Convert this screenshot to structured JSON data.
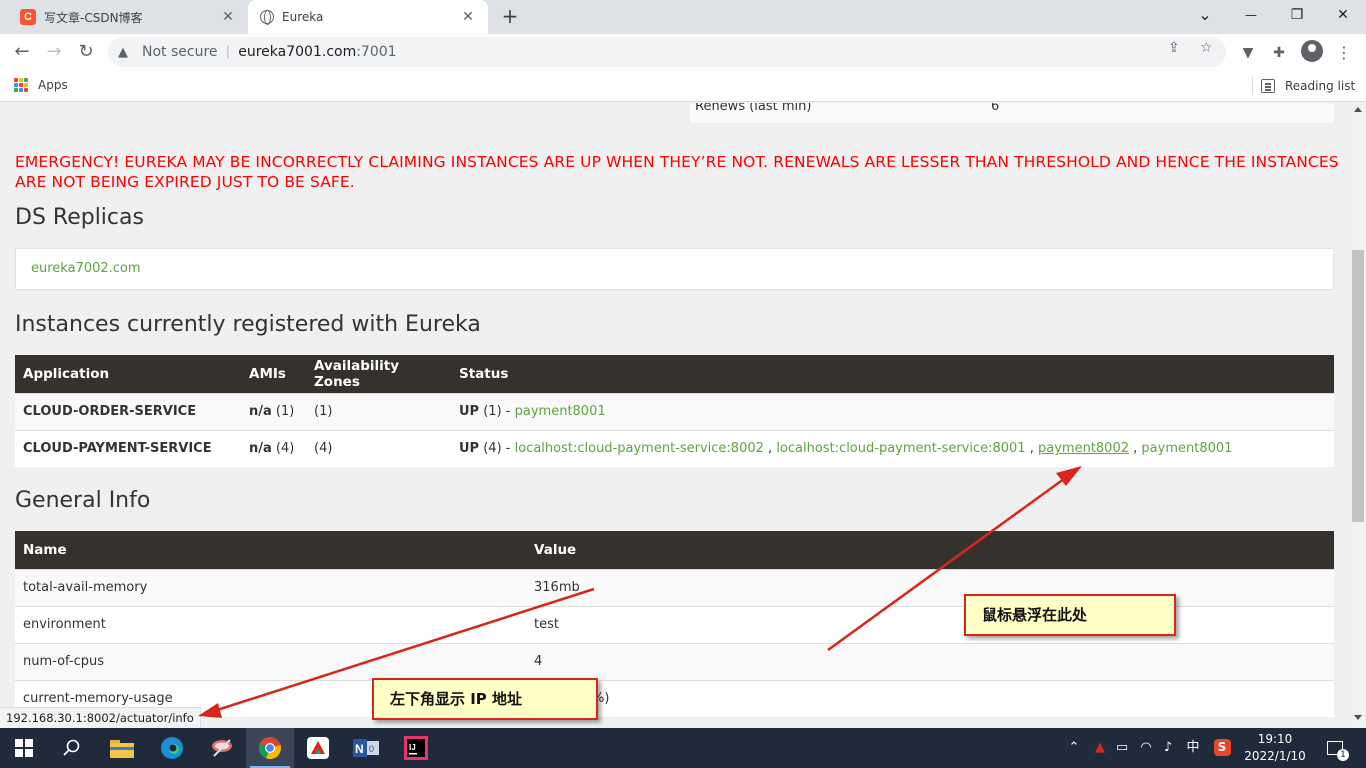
{
  "browser": {
    "tabs": [
      {
        "title": "写文章-CSDN博客",
        "favicon": "C",
        "active": false
      },
      {
        "title": "Eureka",
        "active": true
      }
    ],
    "close_glyph": "✕",
    "new_tab_glyph": "+",
    "window_controls": {
      "chevron": "⌄",
      "minimize": "—",
      "restore": "❐",
      "close": "✕"
    },
    "nav": {
      "back": "←",
      "forward": "→",
      "reload": "↻"
    },
    "security_label": "Not secure",
    "url_host": "eureka7001.com",
    "url_port": ":7001",
    "bookmarks": {
      "apps_label": "Apps",
      "reading_list_label": "Reading list"
    }
  },
  "page": {
    "renews": {
      "label": "Renews (last min)",
      "value": "6"
    },
    "emergency": "EMERGENCY! EUREKA MAY BE INCORRECTLY CLAIMING INSTANCES ARE UP WHEN THEY’RE NOT. RENEWALS ARE LESSER THAN THRESHOLD AND HENCE THE INSTANCES ARE NOT BEING EXPIRED JUST TO BE SAFE.",
    "ds_replicas": {
      "title": "DS Replicas",
      "link": "eureka7002.com"
    },
    "instances": {
      "title": "Instances currently registered with Eureka",
      "headers": [
        "Application",
        "AMIs",
        "Availability Zones",
        "Status"
      ],
      "rows": [
        {
          "app": "CLOUD-ORDER-SERVICE",
          "ami": "n/a",
          "ami_count": "(1)",
          "zones": "(1)",
          "status": "UP",
          "status_count": "(1) -",
          "links": [
            "payment8001"
          ]
        },
        {
          "app": "CLOUD-PAYMENT-SERVICE",
          "ami": "n/a",
          "ami_count": "(4)",
          "zones": "(4)",
          "status": "UP",
          "status_count": "(4) -",
          "links": [
            "localhost:cloud-payment-service:8002",
            "localhost:cloud-payment-service:8001",
            "payment8002",
            "payment8001"
          ]
        }
      ],
      "link_separator": ","
    },
    "general_info": {
      "title": "General Info",
      "headers": [
        "Name",
        "Value"
      ],
      "rows": [
        {
          "name": "total-avail-memory",
          "value": "316mb"
        },
        {
          "name": "environment",
          "value": "test"
        },
        {
          "name": "num-of-cpus",
          "value": "4"
        },
        {
          "name": "current-memory-usage",
          "value": "%)"
        }
      ]
    }
  },
  "status_url": "192.168.30.1:8002/actuator/info",
  "annotations": {
    "hover_note": "鼠标悬浮在此处",
    "ip_note": "左下角显示 IP 地址",
    "arrow_color": "#d9261c"
  },
  "taskbar": {
    "ime": "中",
    "time": "19:10",
    "date": "2022/1/10",
    "notification_count": "1",
    "icons": [
      "windows-start-icon",
      "search-icon",
      "file-explorer-icon",
      "edge-icon",
      "snipping-tool-icon",
      "chrome-icon",
      "wps-icon",
      "onenote-icon",
      "intellij-icon"
    ]
  },
  "colors": {
    "link_green": "#5fa341",
    "header_dark": "#35322e",
    "emergency_red": "#ff0000",
    "note_bg": "#ffffc6"
  }
}
